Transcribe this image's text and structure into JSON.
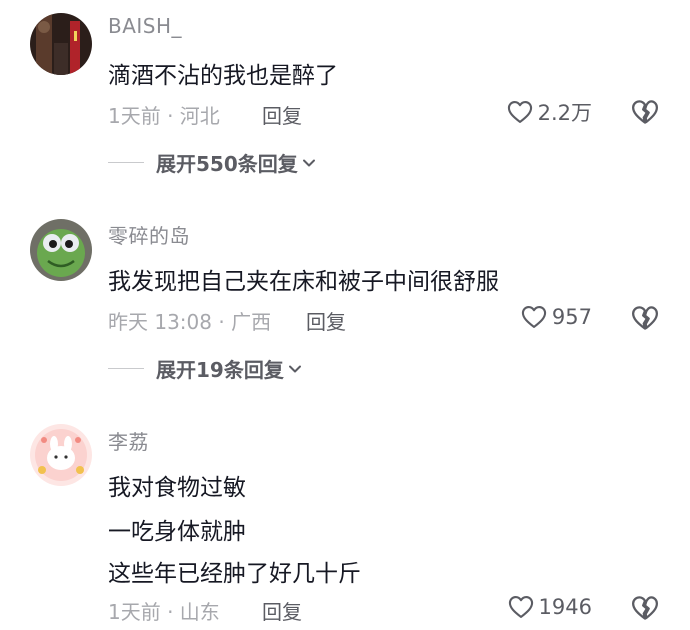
{
  "comments": [
    {
      "username": "BAISH_",
      "lines": [
        "滴酒不沾的我也是醉了"
      ],
      "time_location": "1天前 · 河北",
      "reply_label": "回复",
      "likes": "2.2万",
      "expand_label": "展开550条回复"
    },
    {
      "username": "零碎的岛",
      "lines": [
        "我发现把自己夹在床和被子中间很舒服"
      ],
      "time_location": "昨天 13:08 · 广西",
      "reply_label": "回复",
      "likes": "957",
      "expand_label": "展开19条回复"
    },
    {
      "username": "李荔",
      "lines": [
        "我对食物过敏",
        "一吃身体就肿",
        "这些年已经肿了好几十斤"
      ],
      "time_location": "1天前 · 山东",
      "reply_label": "回复",
      "likes": "1946"
    }
  ],
  "icons": {
    "like": "heart-outline-icon",
    "dislike": "broken-heart-icon",
    "expand": "chevron-down-icon"
  },
  "colors": {
    "text_primary": "#161823",
    "text_secondary": "#8a8b91",
    "text_meta": "#a7a8ad",
    "action": "#5b5c63"
  }
}
